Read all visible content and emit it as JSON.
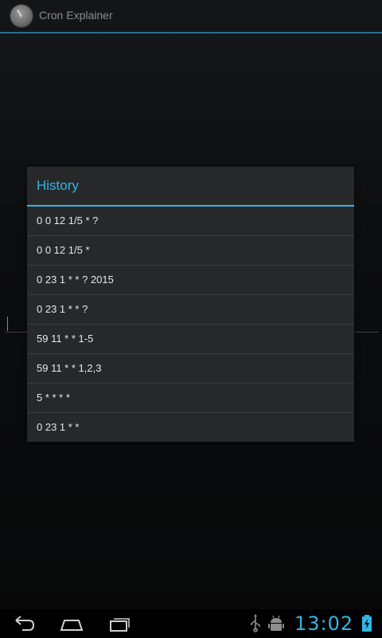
{
  "app": {
    "title": "Cron Explainer",
    "icon": "clock-icon"
  },
  "dialog": {
    "title": "History",
    "items": [
      "0 0 12 1/5 * ?",
      "0 0 12 1/5 *",
      "0 23 1 * * ? 2015",
      "0 23 1 * * ?",
      "59 11 * * 1-5",
      "59 11 * * 1,2,3",
      "5 * * * *",
      "0 23 1 * *"
    ]
  },
  "status_bar": {
    "time": "13:02",
    "icons": [
      "usb-icon",
      "android-debug-icon",
      "battery-charging-icon"
    ]
  },
  "nav_bar": {
    "buttons": [
      "back-icon",
      "home-icon",
      "recent-apps-icon"
    ]
  },
  "colors": {
    "accent": "#33b5e5",
    "dialog_bg": "#272829",
    "text": "#e6e6e6"
  }
}
